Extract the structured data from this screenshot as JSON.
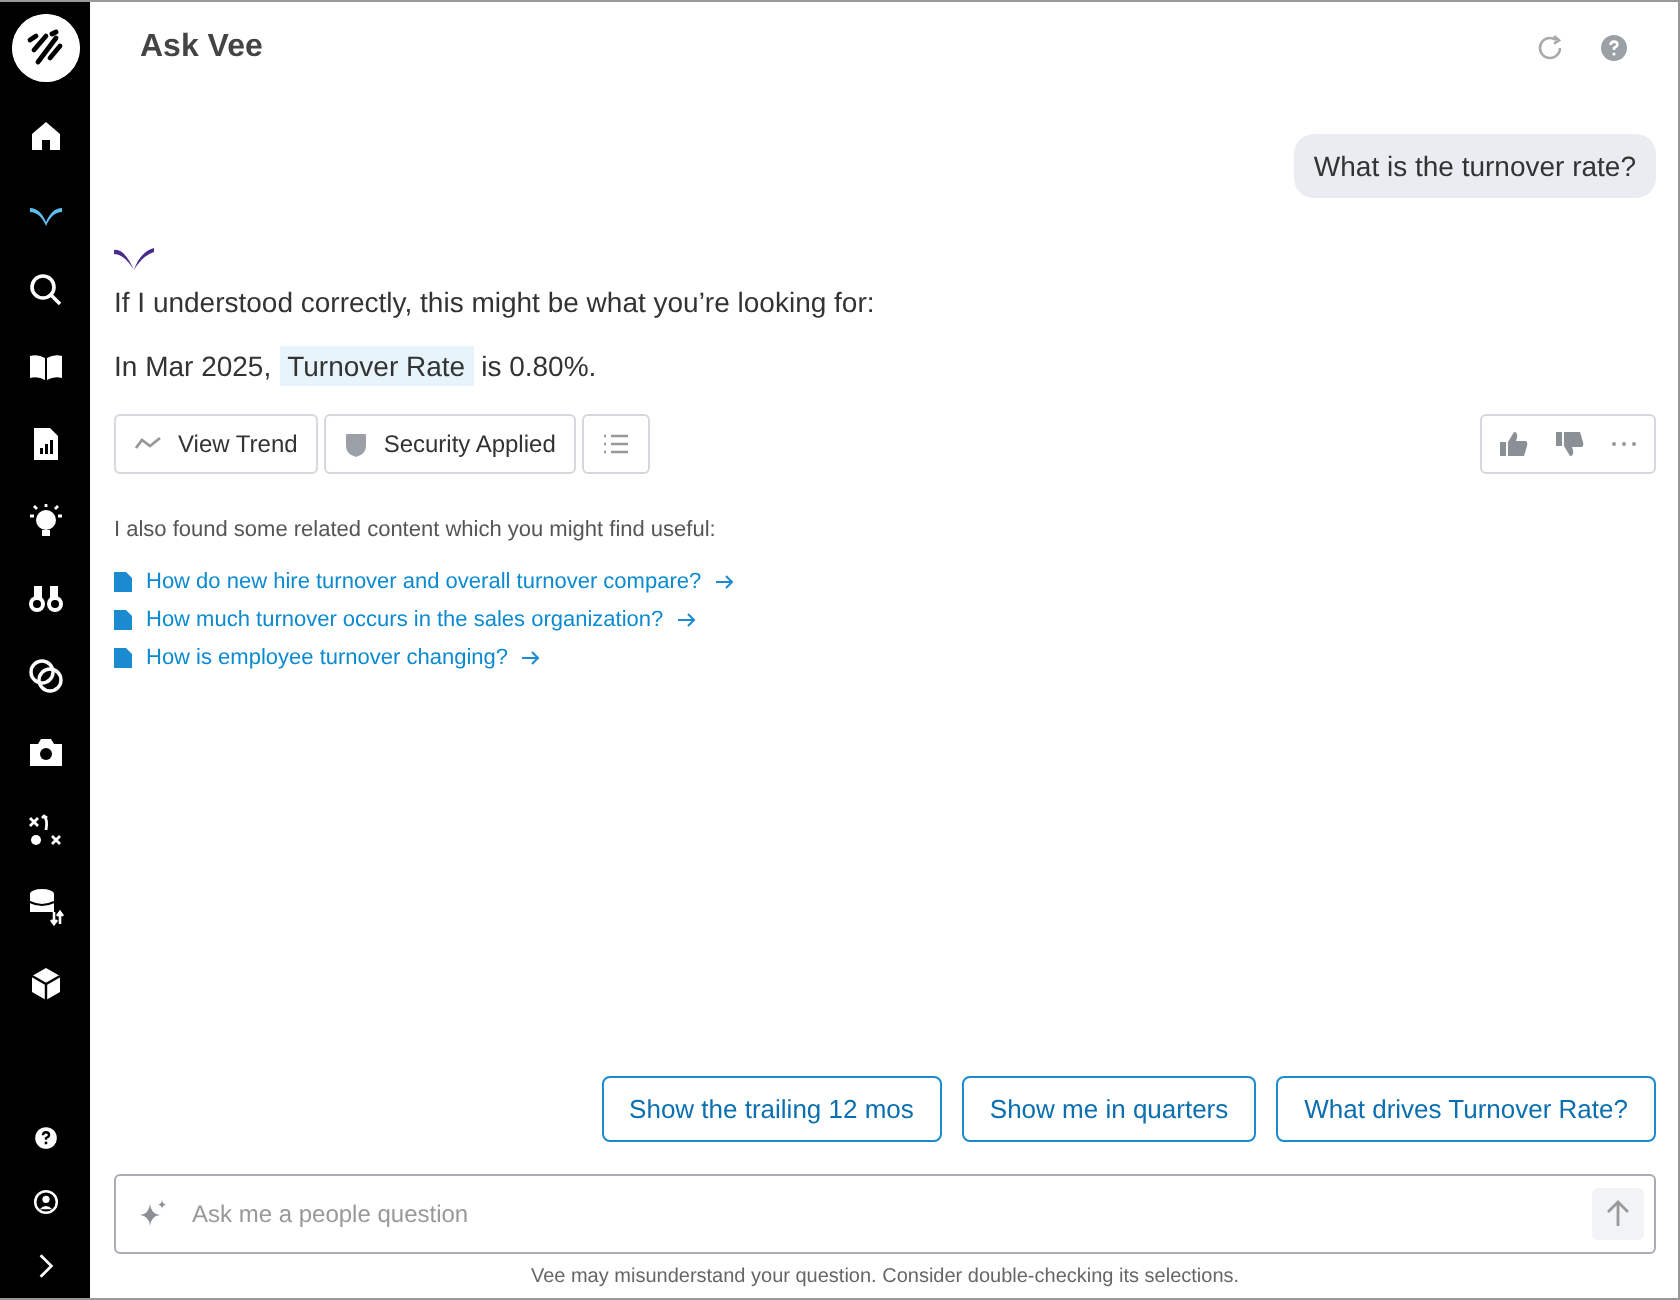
{
  "sidebar": {
    "items": [
      {
        "kind": "home",
        "selected": false
      },
      {
        "kind": "vee",
        "selected": true
      },
      {
        "kind": "search",
        "selected": false
      },
      {
        "kind": "book",
        "selected": false
      },
      {
        "kind": "report",
        "selected": false
      },
      {
        "kind": "bulb",
        "selected": false
      },
      {
        "kind": "binoculars",
        "selected": false
      },
      {
        "kind": "circles",
        "selected": false
      },
      {
        "kind": "camera",
        "selected": false
      },
      {
        "kind": "plays",
        "selected": false
      },
      {
        "kind": "database",
        "selected": false
      },
      {
        "kind": "cube",
        "selected": false
      }
    ],
    "bottom": [
      {
        "kind": "help"
      },
      {
        "kind": "user"
      },
      {
        "kind": "expand"
      }
    ]
  },
  "header": {
    "title": "Ask Vee"
  },
  "user_message": "What is the turnover rate?",
  "answer": {
    "intro": "If I understood correctly, this might be what you’re looking for:",
    "prefix": "In Mar 2025,",
    "metric": "Turnover Rate",
    "suffix": "is 0.80%.",
    "actions": [
      {
        "kind": "trend",
        "label": "View Trend"
      },
      {
        "kind": "security",
        "label": "Security Applied"
      },
      {
        "kind": "list"
      }
    ],
    "related_intro": "I also found some related content which you might find useful:",
    "related": [
      "How do new hire turnover and overall turnover compare?",
      "How much turnover occurs in the sales organization?",
      "How is employee turnover changing?"
    ]
  },
  "suggestions": [
    "Show the trailing 12 mos",
    "Show me in quarters",
    "What drives Turnover Rate?"
  ],
  "input": {
    "placeholder": "Ask me a people question"
  },
  "disclaimer": "Vee may misunderstand your question. Consider double-checking its selections."
}
